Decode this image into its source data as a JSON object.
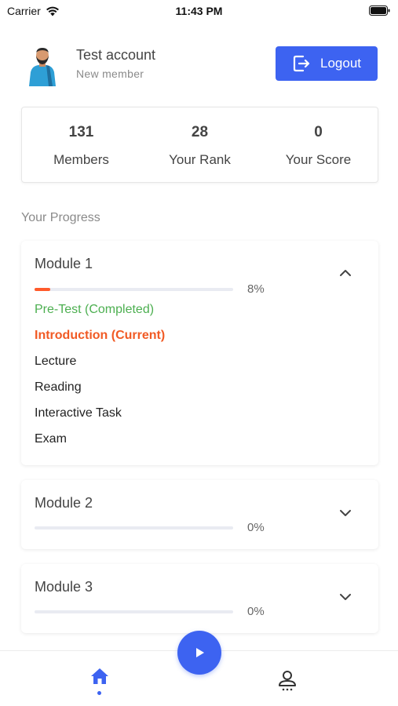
{
  "status_bar": {
    "carrier": "Carrier",
    "time": "11:43 PM",
    "wifi_icon": "wifi-icon",
    "battery_icon": "battery-icon"
  },
  "profile": {
    "name": "Test account",
    "subtitle": "New member",
    "avatar_icon": "person-avatar",
    "logout_label": "Logout",
    "logout_icon": "logout-icon"
  },
  "stats": [
    {
      "value": "131",
      "label": "Members"
    },
    {
      "value": "28",
      "label": "Your Rank"
    },
    {
      "value": "0",
      "label": "Your Score"
    }
  ],
  "progress_section_title": "Your Progress",
  "modules": [
    {
      "title": "Module 1",
      "progress_text": "8%",
      "progress_fraction": 0.08,
      "expanded": true,
      "steps": [
        {
          "label": "Pre-Test (Completed)",
          "state": "completed"
        },
        {
          "label": "Introduction (Current)",
          "state": "current"
        },
        {
          "label": "Lecture",
          "state": "pending"
        },
        {
          "label": "Reading",
          "state": "pending"
        },
        {
          "label": "Interactive Task",
          "state": "pending"
        },
        {
          "label": "Exam",
          "state": "pending"
        }
      ]
    },
    {
      "title": "Module 2",
      "progress_text": "0%",
      "progress_fraction": 0,
      "expanded": false
    },
    {
      "title": "Module 3",
      "progress_text": "0%",
      "progress_fraction": 0,
      "expanded": false
    }
  ],
  "tab_bar": {
    "home_icon": "home-icon",
    "play_icon": "play-icon",
    "profile_icon": "profile-icon"
  },
  "colors": {
    "primary": "#3d63f1",
    "completed": "#4caf50",
    "current": "#f15a24",
    "progress_fill": "#ff5a2b"
  }
}
